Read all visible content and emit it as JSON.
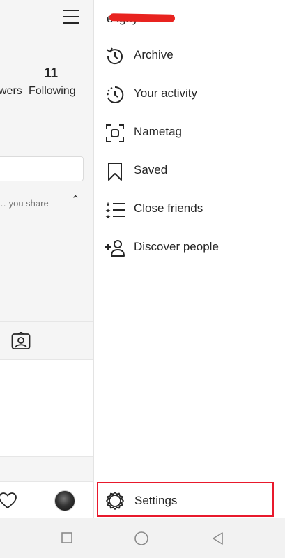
{
  "profile": {
    "followers_label_partial": "wers",
    "following_count": "11",
    "following_label": "Following",
    "partial_text": "… you share"
  },
  "menu": {
    "username": "e          ighy",
    "items": [
      {
        "label": "Archive",
        "icon": "archive-icon"
      },
      {
        "label": "Your activity",
        "icon": "activity-icon"
      },
      {
        "label": "Nametag",
        "icon": "nametag-icon"
      },
      {
        "label": "Saved",
        "icon": "bookmark-icon"
      },
      {
        "label": "Close friends",
        "icon": "close-friends-icon"
      },
      {
        "label": "Discover people",
        "icon": "add-person-icon"
      }
    ],
    "settings_label": "Settings"
  },
  "colors": {
    "highlight": "#e8192c",
    "text": "#262626"
  }
}
